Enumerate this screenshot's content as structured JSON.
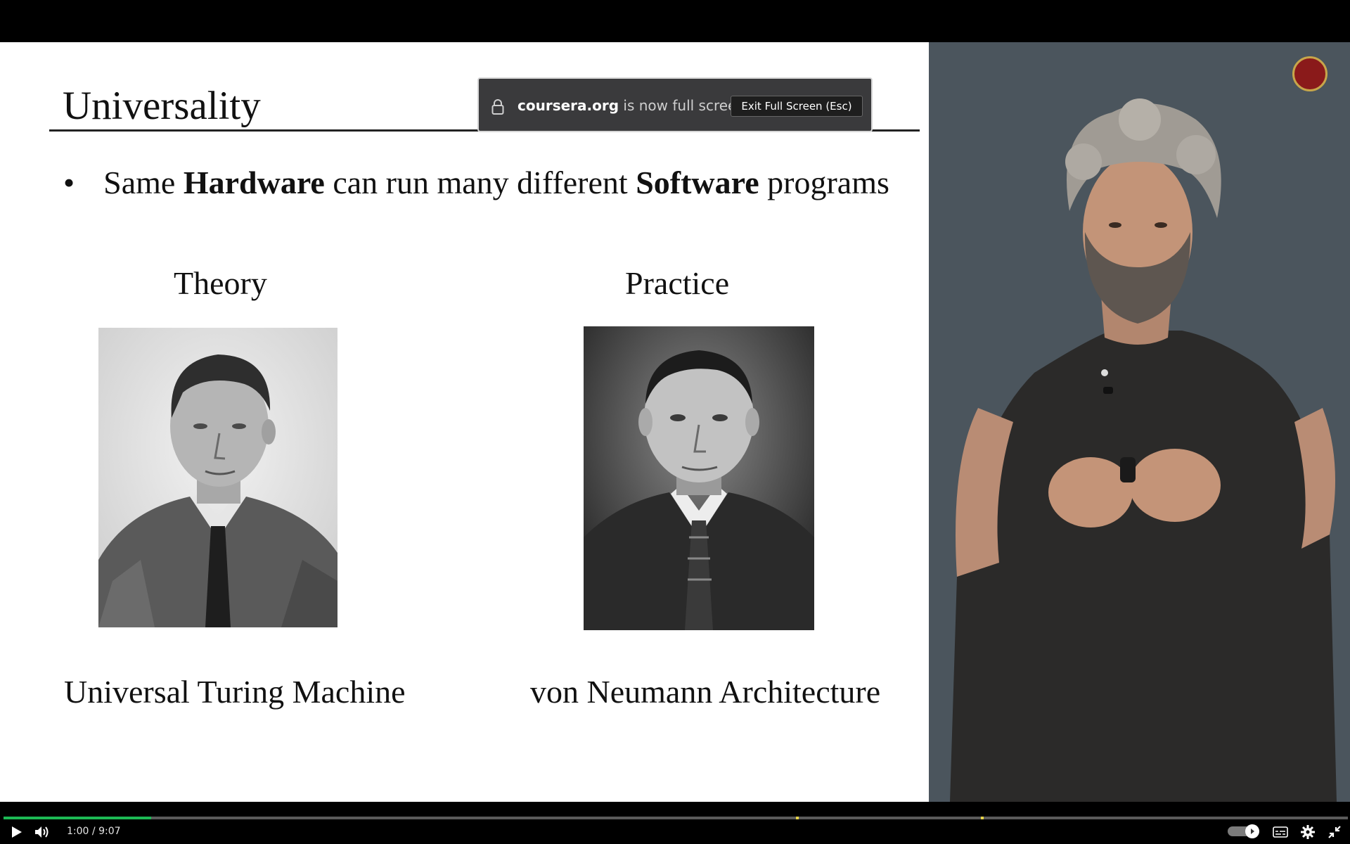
{
  "browser": {
    "fullscreen_domain": "coursera.org",
    "fullscreen_message": "is now full screen",
    "exit_button_label": "Exit Full Screen (Esc)"
  },
  "slide": {
    "title": "Universality",
    "bullet": {
      "marker": "•",
      "parts": [
        "Same ",
        "Hardware",
        " can run many different ",
        "Software",
        " programs"
      ]
    },
    "columns": [
      {
        "heading": "Theory",
        "caption": "Universal Turing Machine"
      },
      {
        "heading": "Practice",
        "caption": "von Neumann Architecture"
      }
    ]
  },
  "player": {
    "current_time": "1:00",
    "time_separator": " / ",
    "duration": "9:07",
    "progress_fraction": 0.11,
    "accent_color": "#1db954",
    "marker_color": "#e5d347",
    "icons": [
      "play-icon",
      "volume-icon",
      "speed-toggle",
      "captions-icon",
      "settings-icon",
      "exit-fullscreen-icon"
    ]
  }
}
